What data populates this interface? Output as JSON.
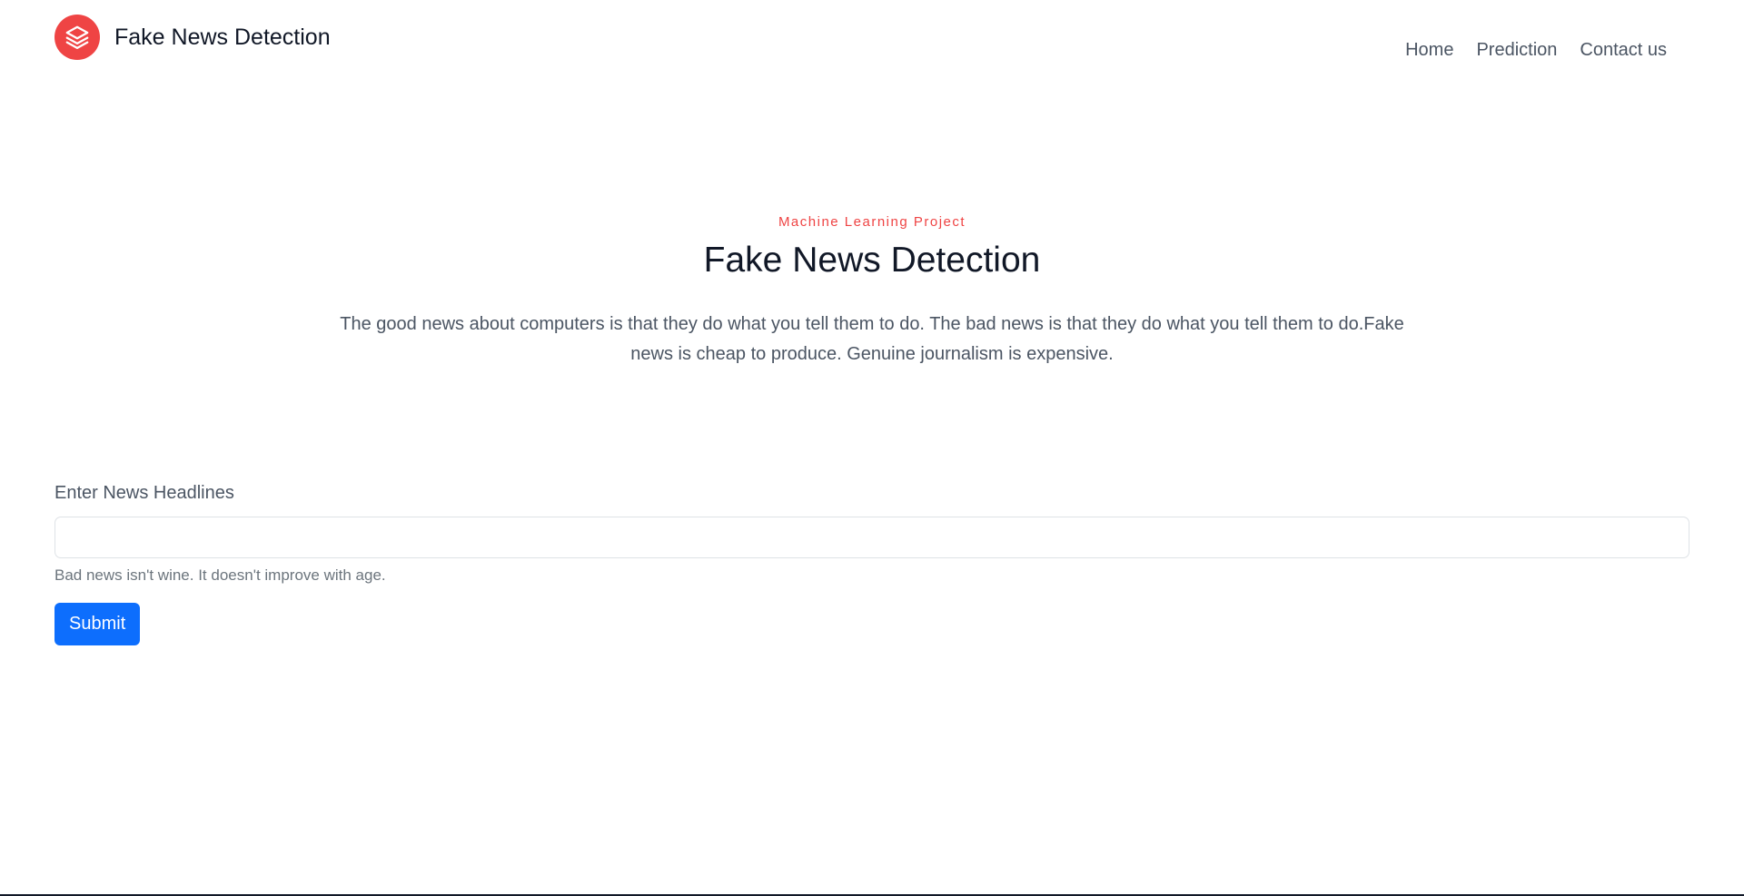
{
  "header": {
    "brand_name": "Fake News Detection",
    "logo_icon": "layers-icon",
    "nav": [
      {
        "label": "Home"
      },
      {
        "label": "Prediction"
      },
      {
        "label": "Contact us"
      }
    ]
  },
  "hero": {
    "eyebrow": "Machine Learning Project",
    "title": "Fake News Detection",
    "lead": "The good news about computers is that they do what you tell them to do. The bad news is that they do what you tell them to do.Fake news is cheap to produce. Genuine journalism is expensive."
  },
  "form": {
    "label": "Enter News Headlines",
    "value": "",
    "placeholder": "",
    "help": "Bad news isn't wine. It doesn't improve with age.",
    "submit_label": "Submit"
  },
  "colors": {
    "accent": "#ef4444",
    "primary_button": "#0d6efd"
  }
}
